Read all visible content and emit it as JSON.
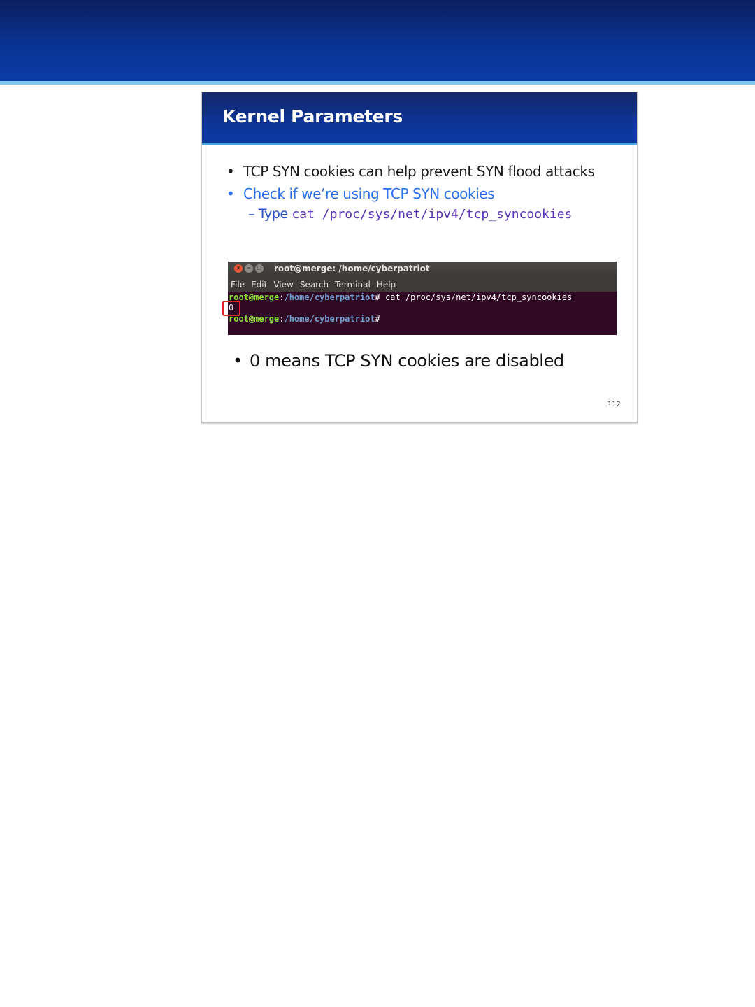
{
  "slide": {
    "title": "Kernel Parameters",
    "bullets": [
      {
        "text": "TCP SYN cookies can help prevent SYN flood attacks",
        "color": "#1a1a1a"
      },
      {
        "text": "Check if we’re using TCP SYN cookies",
        "color": "#2a6ff0"
      }
    ],
    "sub_bullet": {
      "prefix": "– Type",
      "command": "cat /proc/sys/net/ipv4/tcp_syncookies"
    },
    "conclusion": "0 means TCP SYN cookies are disabled",
    "page_number": "112"
  },
  "terminal": {
    "window_title": "root@merge: /home/cyberpatriot",
    "window_buttons": [
      "close-icon",
      "minimize-icon",
      "maximize-icon"
    ],
    "menu": [
      "File",
      "Edit",
      "View",
      "Search",
      "Terminal",
      "Help"
    ],
    "lines": [
      {
        "user": "root@merge",
        "sep": ":",
        "path": "/home/cyberpatriot",
        "prompt": "#",
        "command": " cat /proc/sys/net/ipv4/tcp_syncookies"
      },
      {
        "output": "0"
      },
      {
        "user": "root@merge",
        "sep": ":",
        "path": "/home/cyberpatriot",
        "prompt": "#",
        "command": ""
      }
    ],
    "colors": {
      "background": "#300a24",
      "user": "#8ae234",
      "path": "#729fcf",
      "highlight": "#e0242e"
    }
  },
  "colors": {
    "header_blue": "#0a3493",
    "header_rule": "#7ec8ee",
    "slide_rule": "#4aa3e0"
  }
}
